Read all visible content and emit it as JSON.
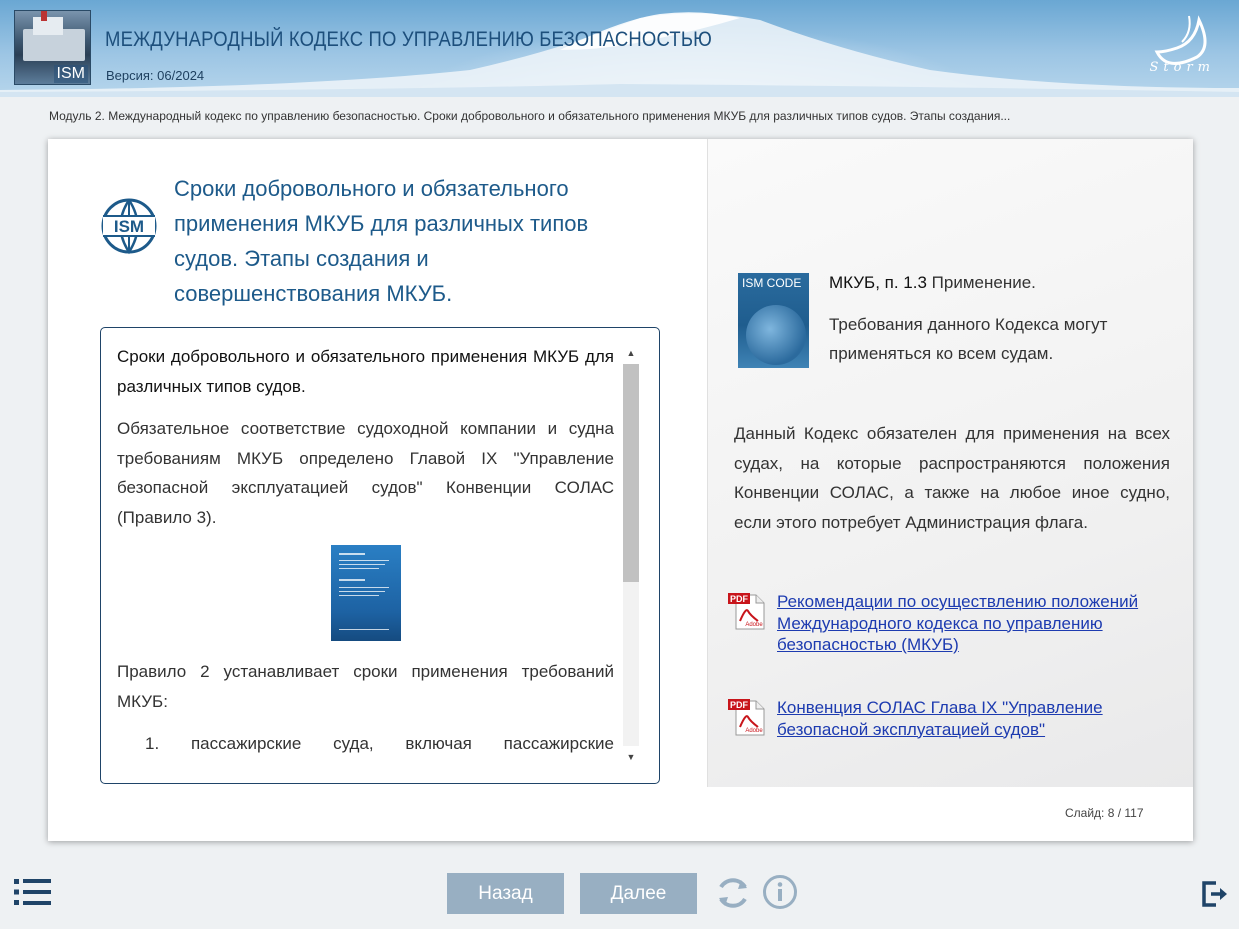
{
  "header": {
    "title": "МЕЖДУНАРОДНЫЙ КОДЕКС ПО УПРАВЛЕНИЮ БЕЗОПАСНОСТЬЮ",
    "version": "Версия: 06/2024",
    "logo_badge": "ISM",
    "brand": "Storm"
  },
  "breadcrumb": "Модуль 2. Международный кодекс по управлению безопасностью. Сроки добровольного и обязательного применения МКУБ для различных типов судов. Этапы создания...",
  "slide": {
    "title": "Сроки добровольного и обязательного применения МКУБ для различных типов судов. Этапы создания и совершенствования МКУБ.",
    "icon_text": "ISM",
    "scroll": {
      "lead": "Сроки добровольного и обязательного применения МКУБ для различных типов судов.",
      "para1": "Обязательное соответствие судоходной компании и судна требованиям МКУБ определено Главой IX \"Управление безопасной эксплуатацией судов\" Конвенции СОЛАС (Правило 3).",
      "para2": "Правило 2 устанавливает сроки применения требований МКУБ:",
      "list_item_1": "1. пассажирские суда, включая пассажирские",
      "scroll_up": "▲",
      "scroll_down": "▼"
    },
    "right": {
      "book_label": "ISM CODE",
      "ref_bold": "МКУБ, п. 1.3",
      "ref_title": " Применение.",
      "ref_text": "Требования данного Кодекса могут применяться ко всем судам.",
      "paragraph": "Данный Кодекс обязателен для применения на всех судах, на которые распространяются положения Конвенции СОЛАС, а также на любое иное судно, если этого потребует Администрация флага.",
      "links": [
        {
          "label": "Рекомендации по осуществлению положений Международного кодекса по управлению безопасностью (МКУБ)"
        },
        {
          "label": "Конвенция СОЛАС Глава IX \"Управление безопасной эксплуатацией судов\""
        }
      ],
      "pdf_label": "PDF",
      "adobe_label": "Adobe"
    },
    "slide_number": "Слайд:  8 / 117"
  },
  "nav": {
    "back": "Назад",
    "next": "Далее"
  },
  "colors": {
    "title_blue": "#1d5a8a",
    "button": "#98afc2",
    "link": "#1d3bb0",
    "nav_icon": "#1f4468"
  }
}
